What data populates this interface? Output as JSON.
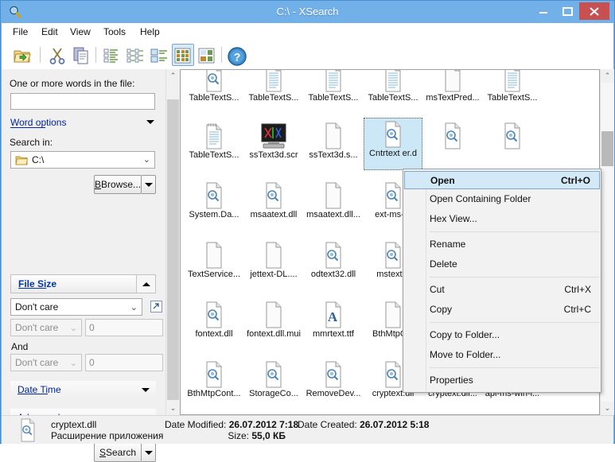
{
  "window": {
    "title": "C:\\ - XSearch",
    "icon": "magnifier-icon",
    "minimize_label": "Minimize",
    "maximize_label": "Maximize",
    "close_label": "Close"
  },
  "menubar": {
    "items": [
      {
        "label": "File"
      },
      {
        "label": "Edit"
      },
      {
        "label": "View"
      },
      {
        "label": "Tools"
      },
      {
        "label": "Help"
      }
    ]
  },
  "toolbar": {
    "buttons": [
      {
        "name": "open-folder-icon",
        "label": "Open Folder"
      },
      {
        "name": "cut-icon",
        "label": "Cut"
      },
      {
        "name": "copy-icon",
        "label": "Copy"
      },
      {
        "name": "view-list-icon",
        "label": "List"
      },
      {
        "name": "view-details-icon",
        "label": "Details"
      },
      {
        "name": "view-tiles-icon",
        "label": "Tiles"
      },
      {
        "name": "view-icons-icon",
        "label": "Icons"
      },
      {
        "name": "view-thumbnails-icon",
        "label": "Thumbnails"
      },
      {
        "name": "help-icon",
        "label": "Help"
      }
    ],
    "active_index": 6
  },
  "search_panel": {
    "words_label": "One or more words in the file:",
    "words_value": "",
    "words_placeholder": "",
    "word_options_label": "Word options",
    "search_in_label": "Search in:",
    "search_in_value": "C:\\",
    "browse_label": "Browse...",
    "file_size": {
      "header": "File Size",
      "unit_value": "Don't care",
      "cond1_value": "Don't care",
      "val1": "0",
      "and_label": "And",
      "cond2_value": "Don't care",
      "val2": "0"
    },
    "date_time_label": "Date Time",
    "advanced_label": "Advanced",
    "search_label": "Search"
  },
  "file_grid": {
    "items": [
      {
        "name": "TableTextS...",
        "icon": "dll-icon"
      },
      {
        "name": "TableTextS...",
        "icon": "text-doc-icon"
      },
      {
        "name": "TableTextS...",
        "icon": "text-doc-icon"
      },
      {
        "name": "TableTextS...",
        "icon": "text-doc-icon"
      },
      {
        "name": "msTextPred...",
        "icon": "blank-doc-icon"
      },
      {
        "name": "TableTextS...",
        "icon": "text-doc-icon"
      },
      {
        "name": "TableTextS...",
        "icon": "notepad-doc-icon"
      },
      {
        "name": "ssText3d.scr",
        "icon": "screensaver-icon"
      },
      {
        "name": "ssText3d.s...",
        "icon": "blank-doc-icon"
      },
      {
        "name": "Cntrtext\ner.d",
        "icon": "dll-icon",
        "selected": true
      },
      {
        "name": "",
        "icon": "dll-icon"
      },
      {
        "name": "",
        "icon": "dll-icon"
      },
      {
        "name": "System.Da...",
        "icon": "dll-icon"
      },
      {
        "name": "msaatext.dll",
        "icon": "dll-icon"
      },
      {
        "name": "msaatext.dll...",
        "icon": "blank-doc-icon"
      },
      {
        "name": "ext-ms-...",
        "icon": "dll-icon"
      },
      {
        "name": "TextService...",
        "icon": "blank-doc-icon"
      },
      {
        "name": "jettext-DL....",
        "icon": "blank-doc-icon"
      },
      {
        "name": "odtext32.dll",
        "icon": "dll-icon"
      },
      {
        "name": "mstext...",
        "icon": "dll-icon"
      },
      {
        "name": "fontext.dll",
        "icon": "dll-icon"
      },
      {
        "name": "fontext.dll.mui",
        "icon": "blank-doc-icon"
      },
      {
        "name": "mmrtext.ttf",
        "icon": "font-icon"
      },
      {
        "name": "BthMtpC...",
        "icon": "blank-doc-icon"
      },
      {
        "name": "BthMtpCont...",
        "icon": "dll-icon"
      },
      {
        "name": "StorageCo...",
        "icon": "dll-icon"
      },
      {
        "name": "RemoveDev...",
        "icon": "dll-icon"
      },
      {
        "name": "cryptext.dll",
        "icon": "dll-icon"
      },
      {
        "name": "cryptext.dll...",
        "icon": "blank-doc-icon"
      },
      {
        "name": "api-ms-win-i...",
        "icon": "dll-icon"
      }
    ]
  },
  "context_menu": {
    "items": [
      {
        "label": "Open",
        "accel": "Ctrl+O",
        "highlighted": true
      },
      {
        "label": "Open Containing Folder",
        "accel": ""
      },
      {
        "label": "Hex View...",
        "accel": ""
      },
      {
        "separator": true
      },
      {
        "label": "Rename",
        "accel": ""
      },
      {
        "label": "Delete",
        "accel": ""
      },
      {
        "separator": true
      },
      {
        "label": "Cut",
        "accel": "Ctrl+X"
      },
      {
        "label": "Copy",
        "accel": "Ctrl+C"
      },
      {
        "separator": true
      },
      {
        "label": "Copy to Folder...",
        "accel": ""
      },
      {
        "label": "Move to Folder...",
        "accel": ""
      },
      {
        "separator": true
      },
      {
        "label": "Properties",
        "accel": ""
      }
    ]
  },
  "status_bar": {
    "file_name": "cryptext.dll",
    "file_type": "Расширение приложения",
    "date_modified_key": "Date Modified:",
    "date_modified_value": "26.07.2012 7:18",
    "date_created_key": "Date Created:",
    "date_created_value": "26.07.2012 5:18",
    "size_key": "Size:",
    "size_value": "55,0 КБ",
    "icon": "dll-icon"
  },
  "colors": {
    "titlebar": "#72b0ea",
    "close_button": "#c75050",
    "selection": "#cce8f7",
    "menu_highlight": "#d4e9f7",
    "link": "#00259c",
    "section_title": "#0033b0"
  }
}
